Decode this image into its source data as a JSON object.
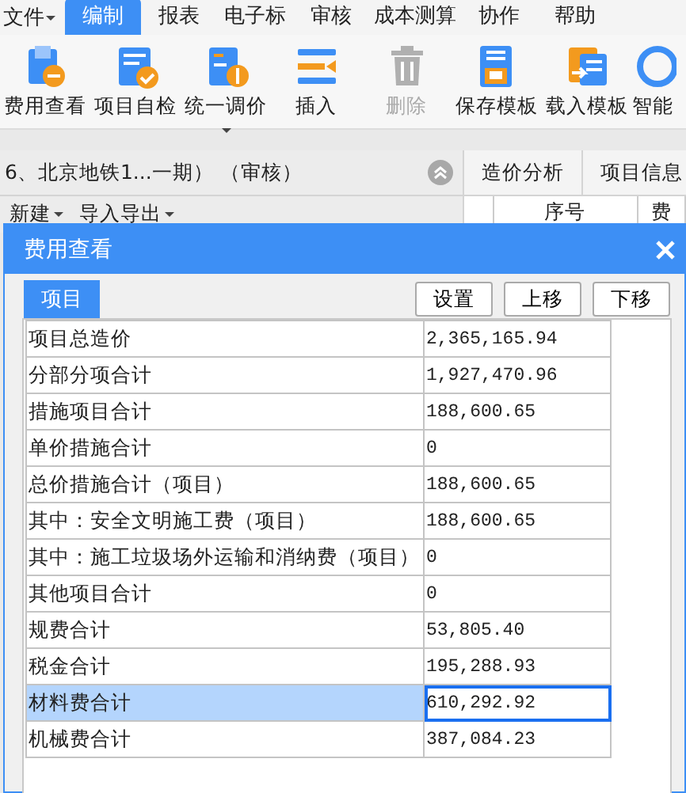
{
  "menu": {
    "file": {
      "label": "文件",
      "dropdown": true
    },
    "tabs": [
      {
        "label": "编制",
        "selected": true
      },
      {
        "label": "报表",
        "selected": false
      },
      {
        "label": "电子标",
        "selected": false
      },
      {
        "label": "审核",
        "selected": false
      },
      {
        "label": "成本测算",
        "selected": false
      },
      {
        "label": "协作",
        "selected": false
      },
      {
        "label": "帮助",
        "selected": false
      }
    ]
  },
  "toolbar": [
    {
      "label": "费用查看",
      "disabled": false,
      "dropdown": false
    },
    {
      "label": "项目自检",
      "disabled": false,
      "dropdown": false
    },
    {
      "label": "统一调价",
      "disabled": false,
      "dropdown": true
    },
    {
      "label": "插入",
      "disabled": false,
      "dropdown": false
    },
    {
      "label": "删除",
      "disabled": true,
      "dropdown": false
    },
    {
      "label": "保存模板",
      "disabled": false,
      "dropdown": false
    },
    {
      "label": "载入模板",
      "disabled": false,
      "dropdown": false
    },
    {
      "label": "智能",
      "disabled": false,
      "dropdown": false
    }
  ],
  "project_bar": {
    "title": "6、北京地铁1...一期） （审核）"
  },
  "project_actions": [
    {
      "label": "新建"
    },
    {
      "label": "导入导出"
    }
  ],
  "right_tabs": [
    {
      "label": "造价分析"
    },
    {
      "label": "项目信息"
    }
  ],
  "right_columns": [
    "序号",
    "费"
  ],
  "dialog": {
    "title": "费用查看",
    "tab": {
      "label": "项目",
      "selected": true
    },
    "buttons": [
      "设置",
      "上移",
      "下移"
    ],
    "rows": [
      {
        "label": "项目总造价",
        "value": "2,365,165.94",
        "selected": false
      },
      {
        "label": "分部分项合计",
        "value": "1,927,470.96",
        "selected": false
      },
      {
        "label": "措施项目合计",
        "value": "188,600.65",
        "selected": false
      },
      {
        "label": "单价措施合计",
        "value": "0",
        "selected": false
      },
      {
        "label": "总价措施合计（项目）",
        "value": "188,600.65",
        "selected": false
      },
      {
        "label": "其中：安全文明施工费（项目）",
        "value": "188,600.65",
        "selected": false
      },
      {
        "label": "其中：施工垃圾场外运输和消纳费（项目）",
        "value": "0",
        "selected": false
      },
      {
        "label": "其他项目合计",
        "value": "0",
        "selected": false
      },
      {
        "label": "规费合计",
        "value": "53,805.40",
        "selected": false
      },
      {
        "label": "税金合计",
        "value": "195,288.93",
        "selected": false
      },
      {
        "label": "材料费合计",
        "value": "610,292.92",
        "selected": true
      },
      {
        "label": "机械费合计",
        "value": "387,084.23",
        "selected": false
      }
    ]
  }
}
